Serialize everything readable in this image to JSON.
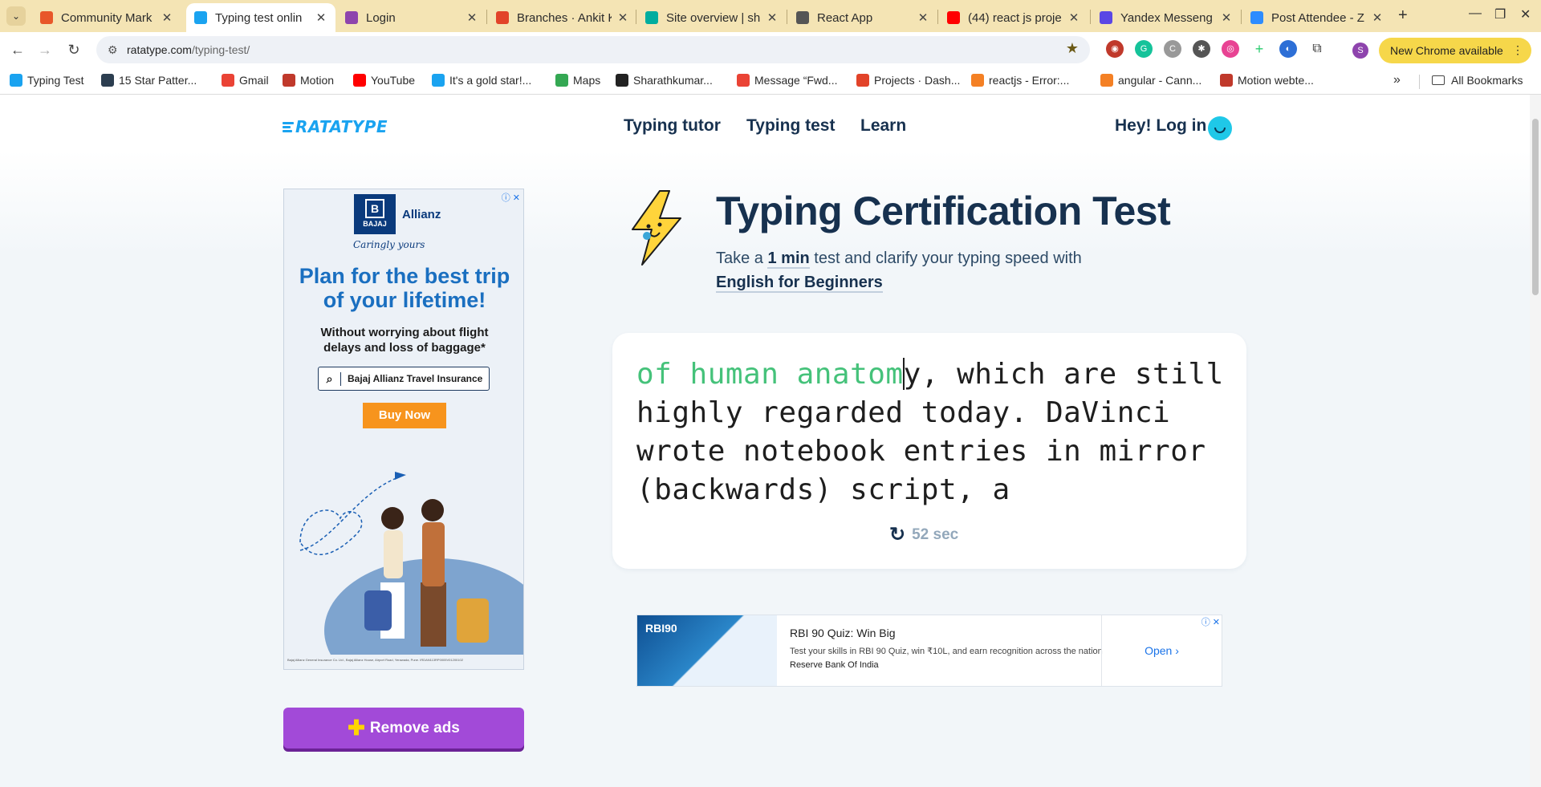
{
  "browser": {
    "tabs": [
      {
        "title": "Community Mark",
        "color": "#e8572a"
      },
      {
        "title": "Typing test onlin",
        "color": "#1aa3f0",
        "active": true
      },
      {
        "title": "Login",
        "color": "#8e44ad"
      },
      {
        "title": "Branches · Ankit K",
        "color": "#e24329"
      },
      {
        "title": "Site overview | sh",
        "color": "#00ad9f"
      },
      {
        "title": "React App",
        "color": "#555555"
      },
      {
        "title": "(44) react js proje",
        "color": "#ff0000"
      },
      {
        "title": "Yandex Messeng",
        "color": "#5a47e5"
      },
      {
        "title": "Post Attendee - Z",
        "color": "#2d8cff"
      }
    ],
    "url_host": "ratatype.com",
    "url_path": "/typing-test/",
    "update_label": "New Chrome available",
    "profile_initial": "S",
    "bookmarks": [
      {
        "label": "Typing Test",
        "color": "#1aa3f0"
      },
      {
        "label": "15 Star Patter...",
        "color": "#2c3e50"
      },
      {
        "label": "Gmail",
        "color": "#ea4335"
      },
      {
        "label": "Motion",
        "color": "#c0392b"
      },
      {
        "label": "YouTube",
        "color": "#ff0000"
      },
      {
        "label": "It's a gold star!...",
        "color": "#1aa3f0"
      },
      {
        "label": "Maps",
        "color": "#34a853"
      },
      {
        "label": "Sharathkumar...",
        "color": "#222222"
      },
      {
        "label": "Message “Fwd...",
        "color": "#ea4335"
      },
      {
        "label": "Projects · Dash...",
        "color": "#e24329"
      },
      {
        "label": "reactjs - Error:...",
        "color": "#f48024"
      },
      {
        "label": "angular - Cann...",
        "color": "#f48024"
      },
      {
        "label": "Motion webte...",
        "color": "#c0392b"
      }
    ],
    "all_bookmarks": "All Bookmarks"
  },
  "site": {
    "logo": "RATATYPE",
    "nav": [
      "Typing tutor",
      "Typing test",
      "Learn"
    ],
    "login": "Hey! Log in"
  },
  "side_ad": {
    "brand_box": "BAJAJ",
    "brand_partner": "Allianz",
    "tagline": "Caringly yours",
    "headline_1": "Plan for the best trip",
    "headline_2": "of your lifetime!",
    "sub_1": "Without worrying about flight",
    "sub_2": "delays and loss of baggage*",
    "search_text": "Bajaj Allianz Travel Insurance",
    "cta": "Buy Now"
  },
  "remove_ads": "Remove ads",
  "hero": {
    "title": "Typing Certification Test",
    "subtitle_pre": "Take a ",
    "duration": "1 min",
    "subtitle_mid": " test and clarify your typing speed with ",
    "course": "English for Beginners"
  },
  "typing": {
    "typed": "of human anatom",
    "remaining": "y, which are still highly regarded today. DaVinci wrote notebook entries in mirror (backwards) script, a",
    "timer": "52 sec"
  },
  "bottom_ad": {
    "title": "RBI 90 Quiz: Win Big",
    "description": "Test your skills in RBI 90 Quiz, win ₹10L, and earn recognition across the nation",
    "source": "Reserve Bank Of India",
    "cta": "Open"
  }
}
